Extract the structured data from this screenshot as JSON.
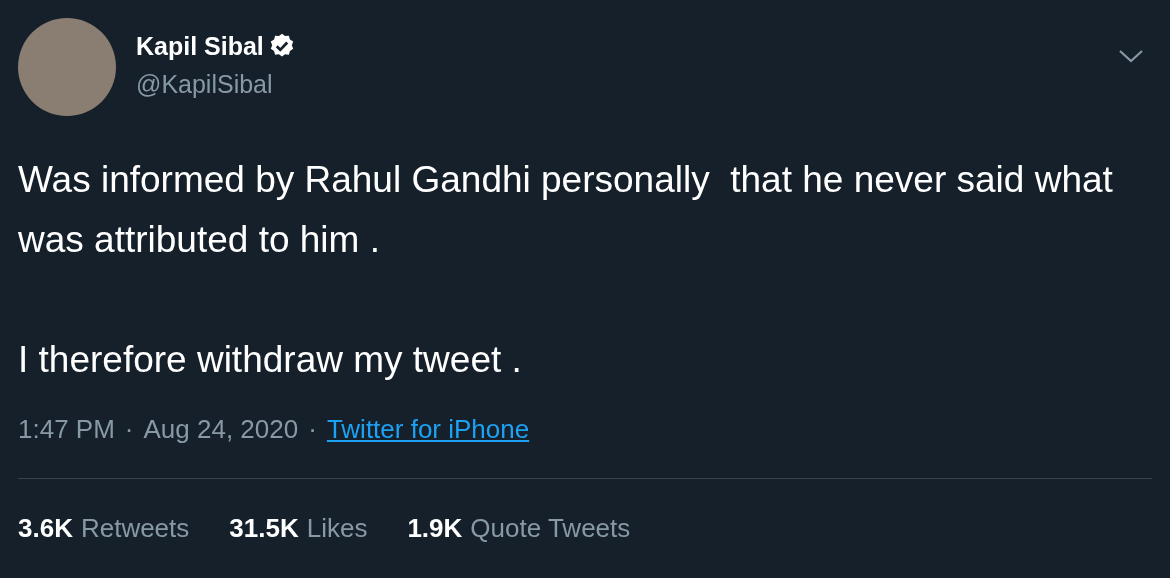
{
  "author": {
    "name": "Kapil Sibal",
    "verified": true,
    "handle": "@KapilSibal"
  },
  "paragraphs": [
    "Was informed by Rahul Gandhi personally  that he never said what was attributed to him .",
    "I therefore withdraw my tweet ."
  ],
  "meta": {
    "time": "1:47 PM",
    "separator_1": "·",
    "date": "Aug 24, 2020",
    "separator_2": "·",
    "source": "Twitter for iPhone"
  },
  "stats": [
    {
      "count": "3.6K",
      "label": "Retweets"
    },
    {
      "count": "31.5K",
      "label": "Likes"
    },
    {
      "count": "1.9K",
      "label": "Quote Tweets"
    }
  ]
}
